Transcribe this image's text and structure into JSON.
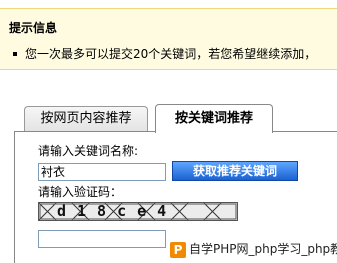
{
  "notice": {
    "title": "提示信息",
    "message": "您一次最多可以提交20个关键词，若您希望继续添加，"
  },
  "tabs": [
    {
      "label": "按网页内容推荐",
      "active": false
    },
    {
      "label": "按关键词推荐",
      "active": true
    }
  ],
  "form": {
    "keyword_label": "请输入关键词名称:",
    "keyword_value": "衬衣",
    "fetch_button": "获取推荐关键词",
    "captcha_label": "请输入验证码：",
    "captcha_text": "d18ce4",
    "captcha_input_value": ""
  },
  "watermark": {
    "logo": "P",
    "text": "自学PHP网_php学习_php教"
  },
  "colors": {
    "notice_bg": "#fffbe0",
    "notice_border": "#f0d77a",
    "button_blue": "#1a62d1"
  }
}
